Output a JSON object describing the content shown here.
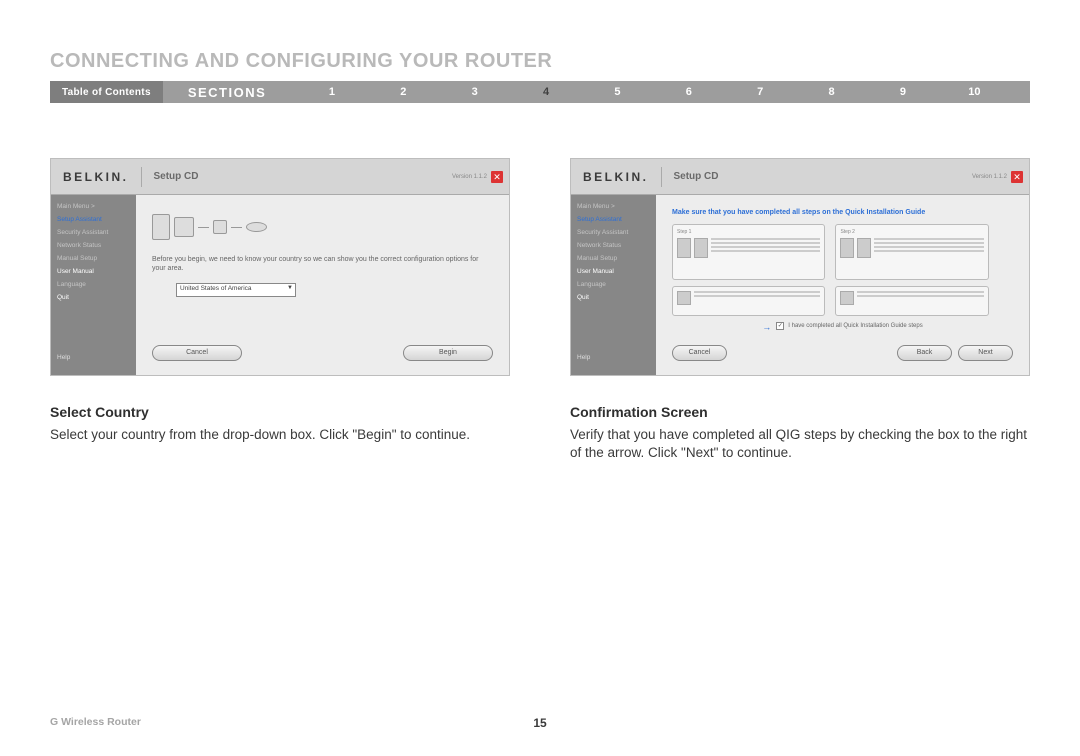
{
  "header": {
    "title": "CONNECTING AND CONFIGURING YOUR ROUTER"
  },
  "nav": {
    "toc_label": "Table of Contents",
    "sections_label": "SECTIONS",
    "numbers": [
      "1",
      "2",
      "3",
      "4",
      "5",
      "6",
      "7",
      "8",
      "9",
      "10"
    ],
    "active": "4"
  },
  "left": {
    "screenshot": {
      "brand": "BELKIN.",
      "subtitle": "Setup CD",
      "version": "Version 1.1.2",
      "sidebar": {
        "main_menu": "Main Menu  >",
        "setup_assistant": "Setup Assistant",
        "security_assistant": "Security Assistant",
        "network_status": "Network Status",
        "manual_setup": "Manual Setup",
        "user_manual": "User Manual",
        "language": "Language",
        "quit": "Quit",
        "help": "Help"
      },
      "body_text": "Before you begin, we need to know your country so we can show you the correct configuration options for your area.",
      "dropdown_value": "United States of America",
      "buttons": {
        "cancel": "Cancel",
        "begin": "Begin"
      }
    },
    "caption_title": "Select Country",
    "caption_body": "Select your country from the drop-down box. Click \"Begin\" to continue."
  },
  "right": {
    "screenshot": {
      "brand": "BELKIN.",
      "subtitle": "Setup CD",
      "version": "Version 1.1.2",
      "sidebar": {
        "main_menu": "Main Menu  >",
        "setup_assistant": "Setup Assistant",
        "security_assistant": "Security Assistant",
        "network_status": "Network Status",
        "manual_setup": "Manual Setup",
        "user_manual": "User Manual",
        "language": "Language",
        "quit": "Quit",
        "help": "Help"
      },
      "instruction": "Make sure that you have completed all steps on the Quick Installation Guide",
      "thumb_label_left": "Step 1",
      "thumb_label_right": "Step 2",
      "checkbox_label": "I have completed all Quick Installation Guide steps",
      "buttons": {
        "cancel": "Cancel",
        "back": "Back",
        "next": "Next"
      }
    },
    "caption_title": "Confirmation Screen",
    "caption_body": "Verify that you have completed all QIG steps by checking the box to the right of the arrow. Click \"Next\" to continue."
  },
  "footer": {
    "product": "G Wireless Router",
    "page_number": "15"
  }
}
